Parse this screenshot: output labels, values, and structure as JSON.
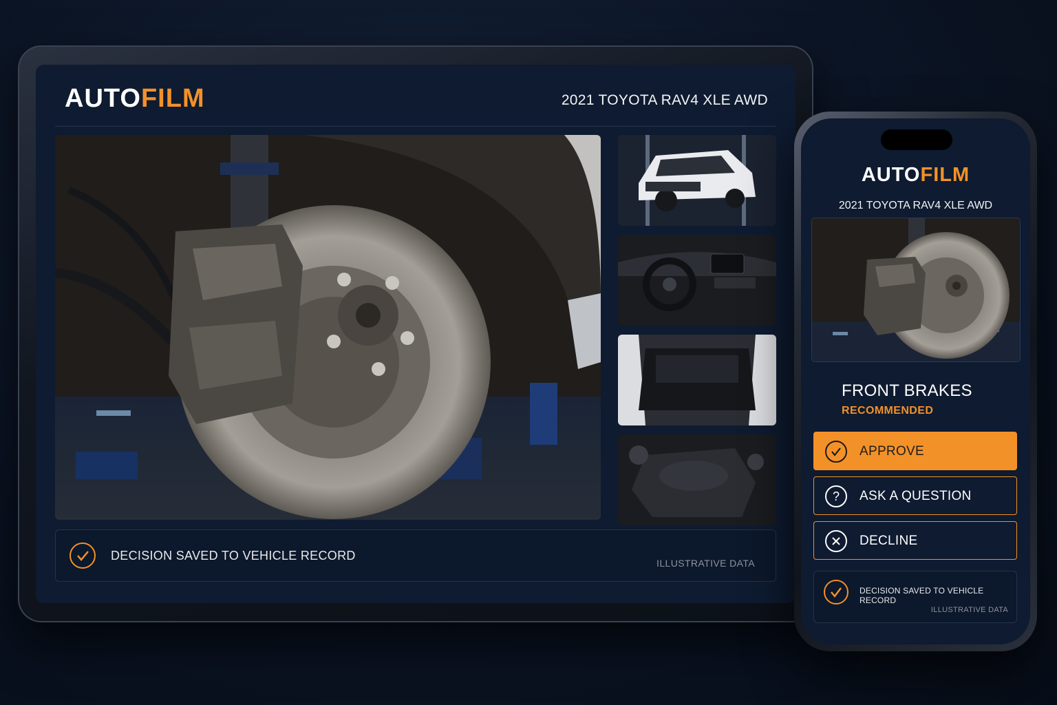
{
  "brand": {
    "logo_part1": "AUTO",
    "logo_part2": "FILM",
    "accent_color": "#f39129"
  },
  "vehicle": {
    "title": "2021 TOYOTA RAV4 XLE AWD"
  },
  "tablet": {
    "main_photo": "front-brake-rotor-caliper-photo",
    "thumbnails": [
      "vehicle-exterior-photo",
      "dashboard-interior-photo",
      "cargo-area-photo",
      "engine-bay-photo"
    ],
    "status_text": "DECISION SAVED TO VEHICLE RECORD",
    "illustrative_note": "ILLUSTRATIVE DATA"
  },
  "phone": {
    "photo": "front-brake-rotor-caliper-photo",
    "service_name": "FRONT BRAKES",
    "service_status": "RECOMMENDED",
    "buttons": {
      "approve": "APPROVE",
      "ask": "ASK A QUESTION",
      "decline": "DECLINE"
    },
    "icons": {
      "approve": "check-icon",
      "ask": "question-icon",
      "decline": "x-icon"
    },
    "status_text": "DECISION SAVED TO VEHICLE RECORD",
    "illustrative_note": "ILLUSTRATIVE DATA"
  }
}
